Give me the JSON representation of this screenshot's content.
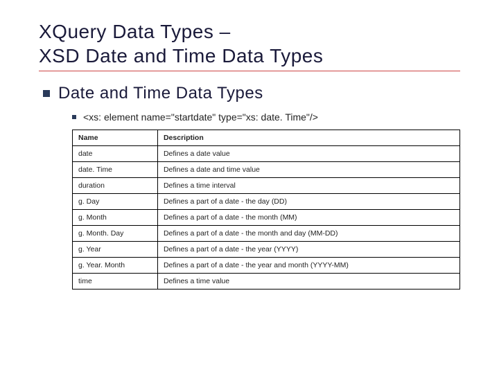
{
  "title_line1": "XQuery Data Types –",
  "title_line2": "XSD Date and Time Data Types",
  "subtitle": "Date and Time Data Types",
  "code_example": "<xs: element name=\"startdate\" type=\"xs: date. Time\"/>",
  "table": {
    "headers": {
      "name": "Name",
      "description": "Description"
    },
    "rows": [
      {
        "name": "date",
        "description": "Defines a date value"
      },
      {
        "name": "date. Time",
        "description": "Defines a date and time value"
      },
      {
        "name": "duration",
        "description": "Defines a time interval"
      },
      {
        "name": "g. Day",
        "description": "Defines a part of a date - the day (DD)"
      },
      {
        "name": "g. Month",
        "description": "Defines a part of a date - the month (MM)"
      },
      {
        "name": "g. Month. Day",
        "description": "Defines a part of a date - the month and day (MM-DD)"
      },
      {
        "name": "g. Year",
        "description": "Defines a part of a date - the year (YYYY)"
      },
      {
        "name": "g. Year. Month",
        "description": "Defines a part of a date - the year and month (YYYY-MM)"
      },
      {
        "name": "time",
        "description": "Defines a time value"
      }
    ]
  }
}
